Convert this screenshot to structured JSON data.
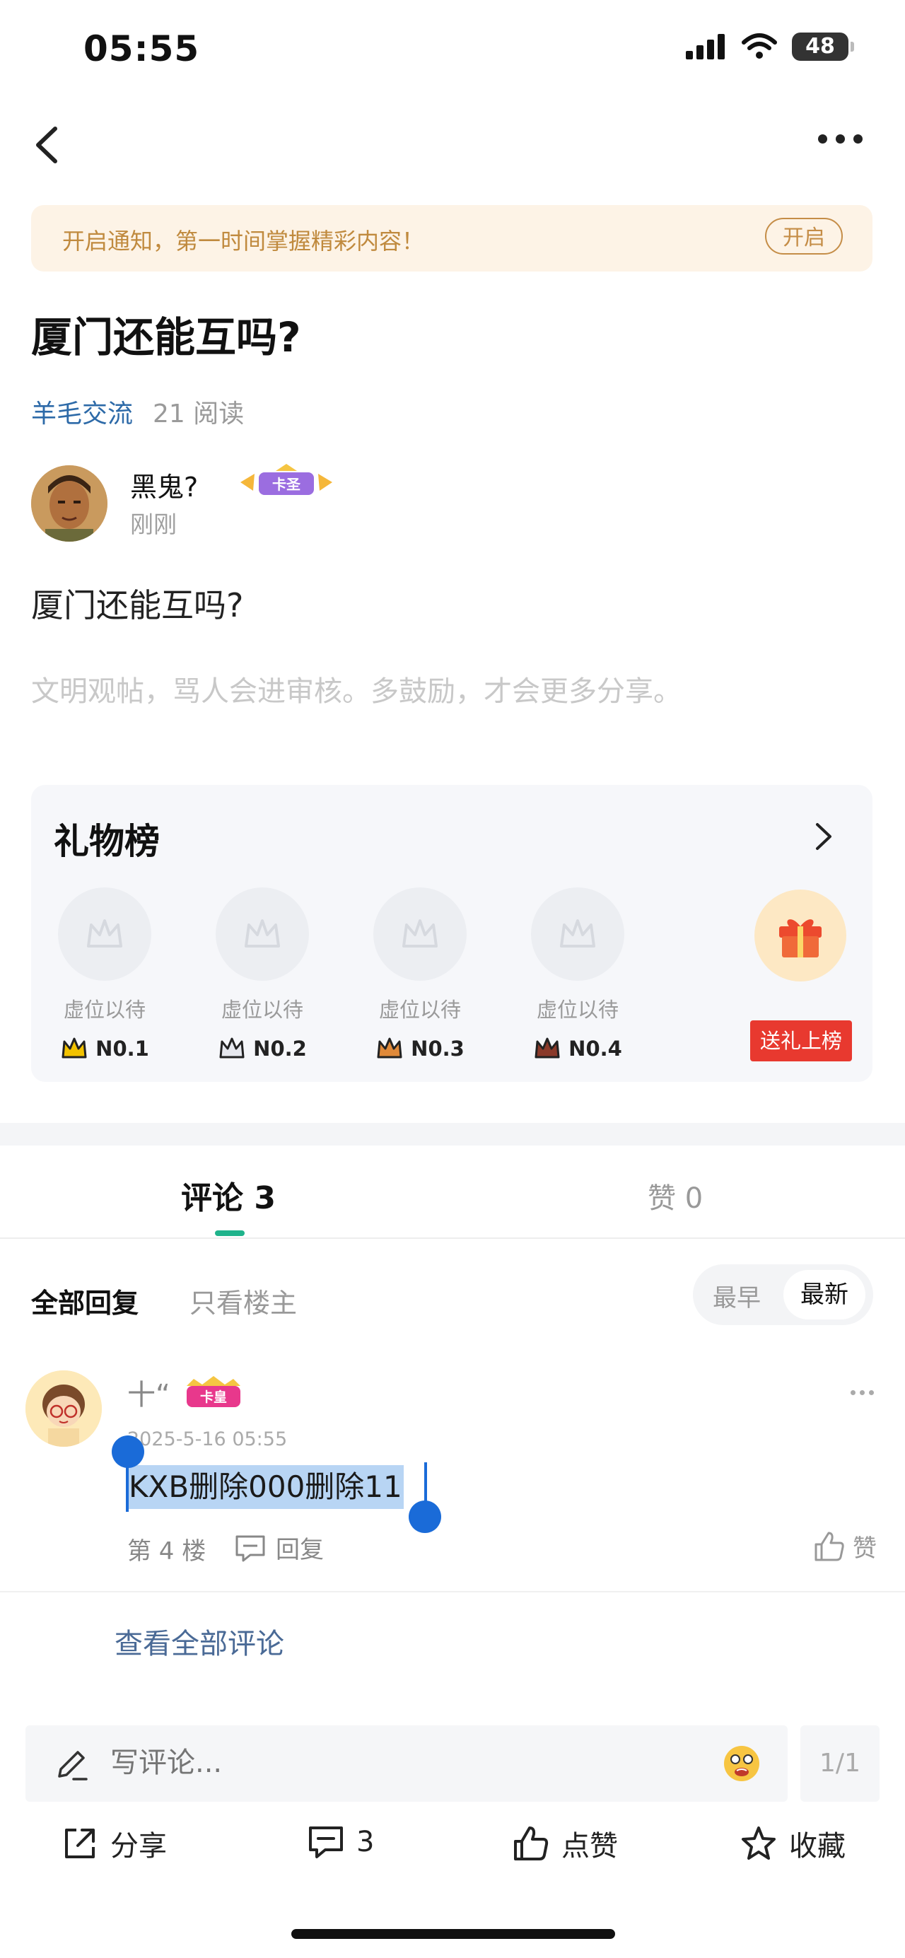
{
  "status_bar": {
    "time": "05:55",
    "battery": "48"
  },
  "notice": {
    "text": "开启通知，第一时间掌握精彩内容！",
    "button": "开启"
  },
  "post": {
    "title": "厦门还能互吗?",
    "board": "羊毛交流",
    "reads": "21 阅读",
    "author": {
      "name": "黑鬼?",
      "badge": "卡圣",
      "time": "刚刚"
    },
    "body": "厦门还能互吗?",
    "hint": "文明观帖，骂人会进审核。多鼓励，才会更多分享。"
  },
  "gift_board": {
    "title": "礼物榜",
    "slots": [
      {
        "label": "虚位以待",
        "rank": "N0.1",
        "crown_color": "#f2c200"
      },
      {
        "label": "虚位以待",
        "rank": "N0.2",
        "crown_color": "#c4c8d0"
      },
      {
        "label": "虚位以待",
        "rank": "N0.3",
        "crown_color": "#e08a3a"
      },
      {
        "label": "虚位以待",
        "rank": "N0.4",
        "crown_color": "#8a3a2a"
      }
    ],
    "send_button": "送礼上榜"
  },
  "tabs": {
    "comments": "评论 3",
    "likes": "赞 0"
  },
  "filters": {
    "all": "全部回复",
    "owner_only": "只看楼主",
    "sort_earliest": "最早",
    "sort_newest": "最新"
  },
  "comment": {
    "name": "十“",
    "badge": "卡皇",
    "time": "2025-5-16 05:55",
    "text": "KXB删除000删除11",
    "floor": "第 4 楼",
    "reply": "回复",
    "like": "赞"
  },
  "view_all": "查看全部评论",
  "input": {
    "placeholder": "写评论...",
    "page": "1/1"
  },
  "actions": {
    "share": "分享",
    "comments": "3",
    "like": "点赞",
    "favorite": "收藏"
  },
  "colors": {
    "accent": "#1fb38b",
    "board_link": "#2d6aa8",
    "gift_red": "#e8392f",
    "selection": "#1a6bd8"
  }
}
